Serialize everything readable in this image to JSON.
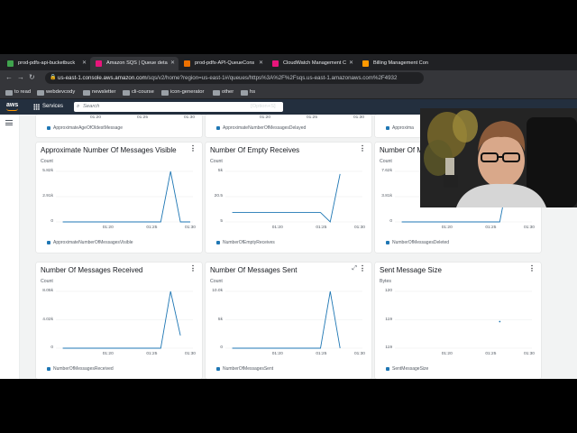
{
  "browser": {
    "tabs": [
      {
        "label": "prod-pdfs-api-bucketbuck",
        "color": "#3fa34d"
      },
      {
        "label": "Amazon SQS | Queue deta",
        "color": "#e7157b"
      },
      {
        "label": "prod-pdfs-API-QueueCons",
        "color": "#ed7100"
      },
      {
        "label": "CloudWatch Management C",
        "color": "#e7157b"
      },
      {
        "label": "Billing Management Con",
        "color": "#ff9900"
      }
    ],
    "url_host": "us-east-1.console.aws.amazon.com",
    "url_path": "/sqs/v2/home?region=us-east-1#/queues/https%3A%2F%2Fsqs.us-east-1.amazonaws.com%2F4932",
    "bookmarks": [
      "to read",
      "webdevcody",
      "newsletter",
      "cli-course",
      "icon-generator",
      "other",
      "hs"
    ]
  },
  "aws": {
    "logo": "aws",
    "services_label": "Services",
    "search_placeholder": "Search",
    "shortcut": "[Option+S]"
  },
  "colors": {
    "series": "#1f77b4",
    "aws_nav": "#232f3e",
    "accent": "#ff9900"
  },
  "top_row": {
    "widgets": [
      {
        "xticks": [
          "01:20",
          "01:25",
          "01:30"
        ],
        "legend": "ApproximateAgeOfOldestMessage"
      },
      {
        "xticks": [
          "01:20",
          "01:25",
          "01:30"
        ],
        "legend": "ApproximateNumberOfMessagesDelayed"
      },
      {
        "xticks": [
          "01:20"
        ],
        "legend": "Approxima"
      }
    ]
  },
  "widgets": [
    {
      "id": "visible",
      "title": "Approximate Number Of Messages Visible",
      "unit": "Count",
      "yticks": [
        "5.82k",
        "2.91k",
        "0"
      ],
      "xticks": [
        "01:20",
        "01:25",
        "01:30"
      ],
      "legend": "ApproximateNumberOfMessagesVisible",
      "chart_data": {
        "type": "line",
        "ylim": [
          0,
          5820
        ],
        "x": [
          "01:17",
          "01:20",
          "01:25",
          "01:27",
          "01:28",
          "01:29",
          "01:30"
        ],
        "values": [
          0,
          0,
          0,
          0,
          5820,
          0,
          0
        ]
      }
    },
    {
      "id": "empty",
      "title": "Number Of Empty Receives",
      "unit": "Count",
      "yticks": [
        "5k",
        "20.5",
        "5"
      ],
      "xticks": [
        "01:20",
        "01:25",
        "01:30"
      ],
      "legend": "NumberOfEmptyReceives",
      "chart_data": {
        "type": "line",
        "scale": "log",
        "ylim": [
          5,
          5000
        ],
        "x": [
          "01:17",
          "01:20",
          "01:25",
          "01:26",
          "01:27",
          "01:28"
        ],
        "values": [
          18,
          18,
          18,
          18,
          5,
          3500
        ]
      }
    },
    {
      "id": "deleted",
      "title": "Number Of M",
      "unit": "Count",
      "yticks": [
        "7.62k",
        "3.81k",
        "0"
      ],
      "xticks": [
        "01:20",
        "01:25",
        "01:30"
      ],
      "legend": "NumberOfMessagesDeleted",
      "chart_data": {
        "type": "line",
        "ylim": [
          0,
          7620
        ],
        "x": [
          "01:17",
          "01:20",
          "01:25",
          "01:27",
          "01:28",
          "01:29"
        ],
        "values": [
          0,
          0,
          0,
          0,
          7620,
          2600
        ]
      }
    },
    {
      "id": "received",
      "title": "Number Of Messages Received",
      "unit": "Count",
      "yticks": [
        "8.05k",
        "4.02k",
        "0"
      ],
      "xticks": [
        "01:20",
        "01:25",
        "01:30"
      ],
      "legend": "NumberOfMessagesReceived",
      "chart_data": {
        "type": "line",
        "ylim": [
          0,
          8050
        ],
        "x": [
          "01:17",
          "01:20",
          "01:25",
          "01:27",
          "01:28",
          "01:29"
        ],
        "values": [
          0,
          0,
          0,
          0,
          8050,
          1800
        ]
      }
    },
    {
      "id": "sent",
      "title": "Number Of Messages Sent",
      "unit": "Count",
      "yticks": [
        "10.0k",
        "5k",
        "0"
      ],
      "xticks": [
        "01:20",
        "01:25",
        "01:30"
      ],
      "legend": "NumberOfMessagesSent",
      "chart_data": {
        "type": "line",
        "ylim": [
          0,
          10000
        ],
        "x": [
          "01:17",
          "01:20",
          "01:25",
          "01:26",
          "01:27",
          "01:28"
        ],
        "values": [
          0,
          0,
          0,
          0,
          10000,
          0
        ]
      }
    },
    {
      "id": "size",
      "title": "Sent Message Size",
      "unit": "Bytes",
      "yticks": [
        "120",
        "119",
        "119"
      ],
      "xticks": [
        "01:20",
        "01:25",
        "01:30"
      ],
      "legend": "SentMessageSize",
      "chart_data": {
        "type": "scatter",
        "x": [
          "01:27"
        ],
        "values": [
          119
        ]
      }
    }
  ]
}
